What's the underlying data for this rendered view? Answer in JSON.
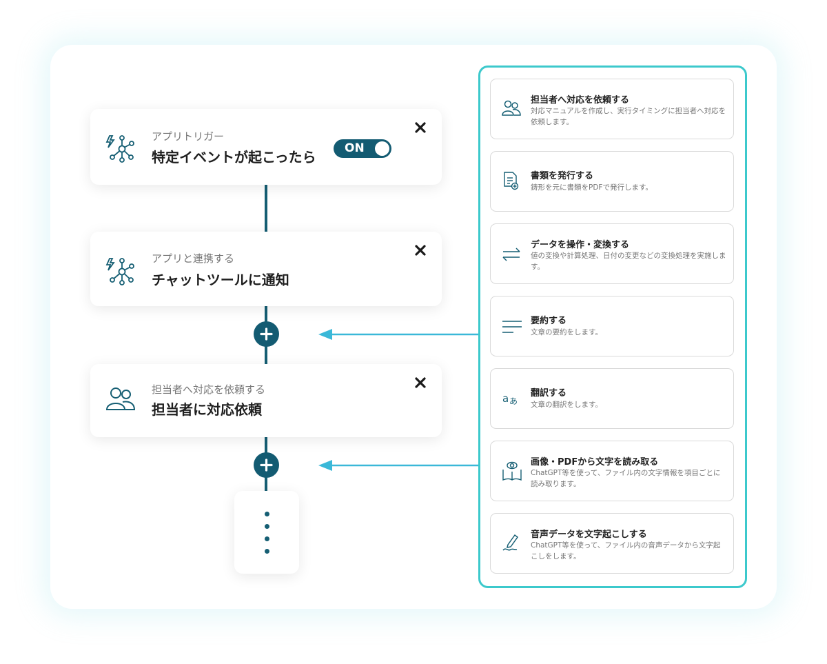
{
  "flow": {
    "trigger": {
      "subtitle": "アプリトリガー",
      "title": "特定イベントが起こったら",
      "toggle_label": "ON"
    },
    "step1": {
      "subtitle": "アプリと連携する",
      "title": "チャットツールに通知"
    },
    "step2": {
      "subtitle": "担当者へ対応を依頼する",
      "title": "担当者に対応依頼"
    }
  },
  "options": [
    {
      "title": "担当者へ対応を依頼する",
      "desc": "対応マニュアルを作成し、実行タイミングに担当者へ対応を依頼します。",
      "icon": "people-icon"
    },
    {
      "title": "書類を発行する",
      "desc": "鋳形を元に書類をPDFで発行します。",
      "icon": "document-icon"
    },
    {
      "title": "データを操作・変換する",
      "desc": "値の変換や計算処理、日付の変更などの変換処理を実施します。",
      "icon": "convert-arrows-icon"
    },
    {
      "title": "要約する",
      "desc": "文章の要約をします。",
      "icon": "summary-lines-icon"
    },
    {
      "title": "翻訳する",
      "desc": "文章の翻訳をします。",
      "icon": "translate-icon"
    },
    {
      "title": "画像・PDFから文字を読み取る",
      "desc": "ChatGPT等を使って、ファイル内の文字情報を項目ごとに読み取ります。",
      "icon": "book-eye-icon"
    },
    {
      "title": "音声データを文字起こしする",
      "desc": "ChatGPT等を使って、ファイル内の音声データから文字起こしをします。",
      "icon": "pen-icon"
    }
  ],
  "colors": {
    "primary": "#135b72",
    "accent": "#3cc9cc",
    "arrow": "#3ab8d8"
  }
}
